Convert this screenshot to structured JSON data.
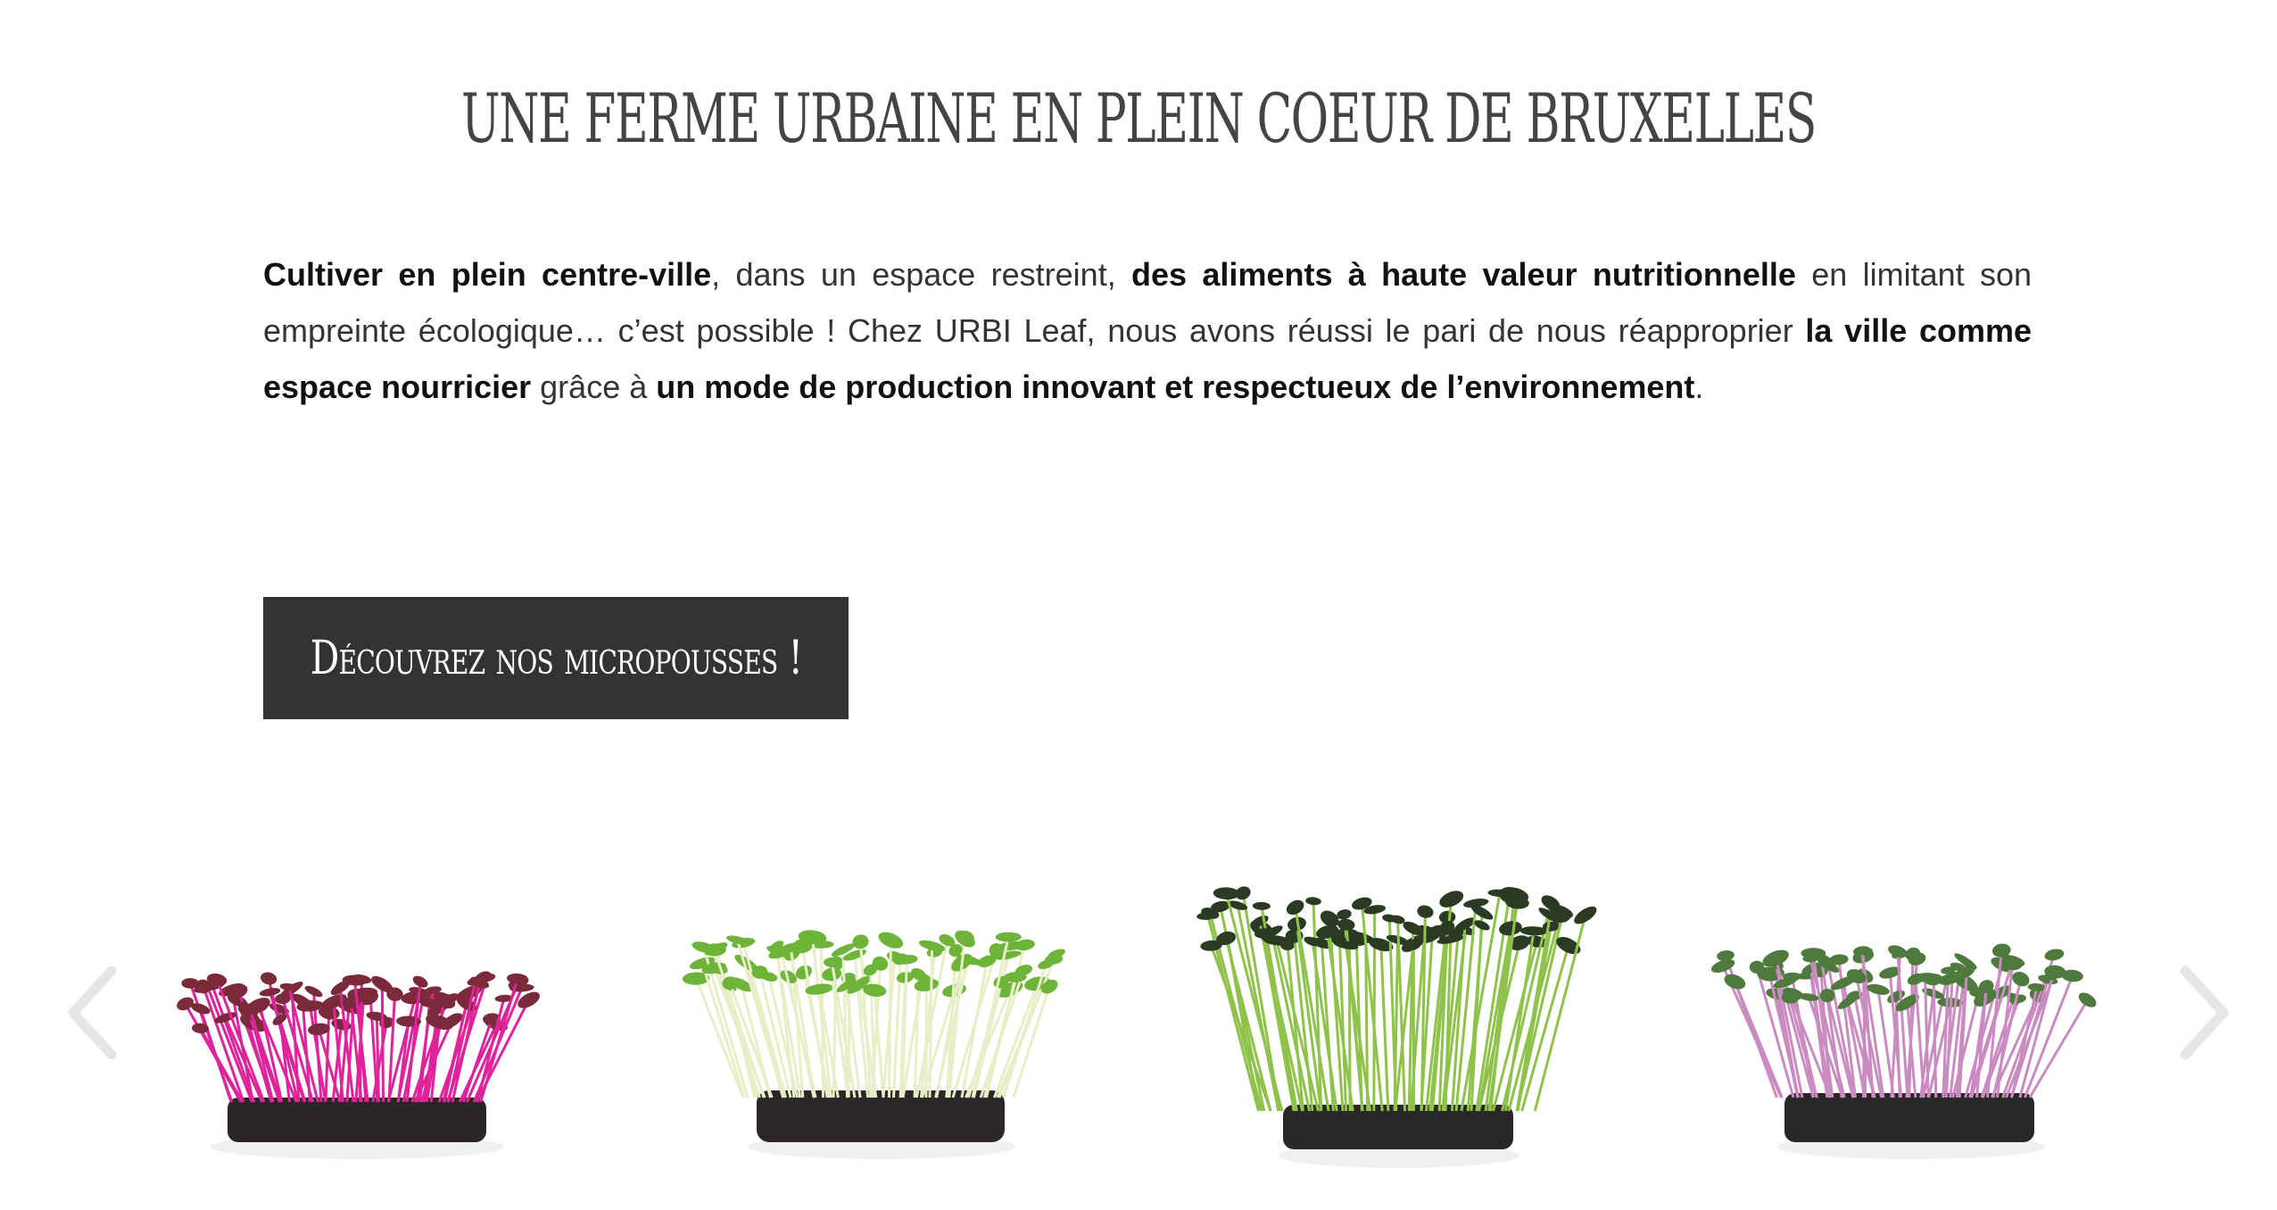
{
  "header": {
    "title": "UNE FERME URBAINE EN PLEIN COEUR DE BRUXELLES"
  },
  "intro": {
    "p1_bold": "Cultiver en plein centre-ville",
    "p1_text": ", dans un espace restreint, ",
    "p2_bold": "des aliments à haute valeur nutritionnelle",
    "p2_text": " en limitant son empreinte écologique… c’est possible ! Chez URBI Leaf, nous avons réussi le pari de nous réapproprier ",
    "p3_bold": "la ville comme espace nourricier",
    "p3_text": " grâce à ",
    "p4_bold": "un mode de production innovant et respectueux de l’environnement",
    "p4_text": "."
  },
  "cta": {
    "label": "Découvrez nos micropousses !"
  },
  "carousel": {
    "prev_icon": "chevron-left-icon",
    "next_icon": "chevron-right-icon",
    "slides": [
      {
        "name": "amaranth-microgreens-image",
        "stem_color": "#e0239a",
        "leaf_color": "#7a2a3a"
      },
      {
        "name": "sunflower-microgreens-image",
        "stem_color": "#e8efc8",
        "leaf_color": "#6fb43a"
      },
      {
        "name": "chive-microgreens-image",
        "stem_color": "#8fc24a",
        "leaf_color": "#2b3a22"
      },
      {
        "name": "radish-microgreens-image",
        "stem_color": "#c98bc0",
        "leaf_color": "#4f7a3e"
      }
    ]
  },
  "colors": {
    "title": "#444444",
    "button_bg": "#333333",
    "button_text": "#ffffff",
    "arrow": "#e6e6e6"
  }
}
